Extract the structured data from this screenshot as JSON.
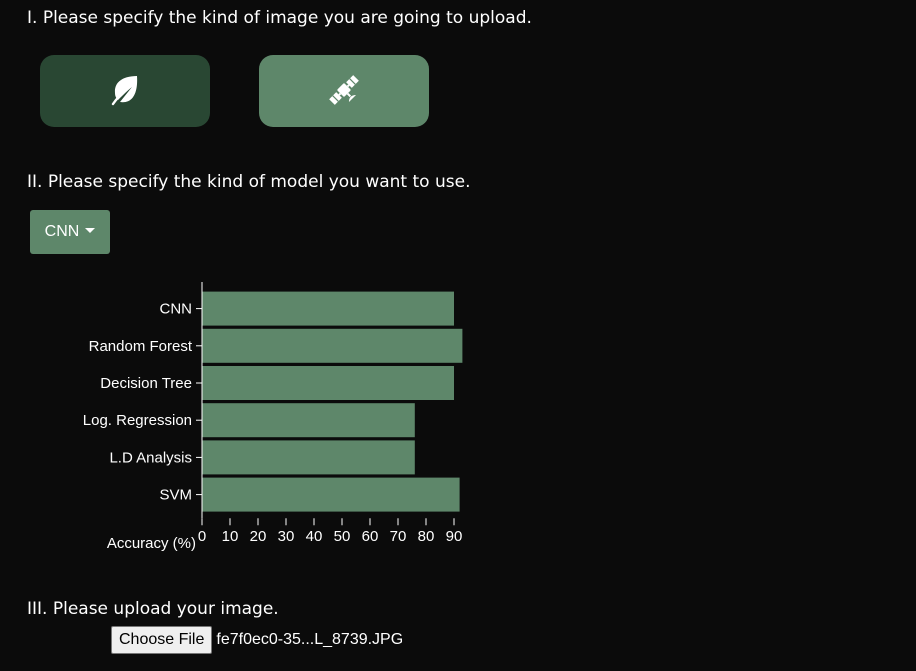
{
  "sections": {
    "image_type_heading": "I. Please specify the kind of image you are going to upload.",
    "model_heading": "II. Please specify the kind of model you want to use.",
    "upload_heading": "III. Please upload your image."
  },
  "image_type_buttons": [
    {
      "icon": "leaf-icon",
      "color": "#294733",
      "selected": true
    },
    {
      "icon": "satellite-icon",
      "color": "#5e876a",
      "selected": false
    }
  ],
  "model_dropdown": {
    "selected": "CNN",
    "color": "#5e876a"
  },
  "chart_data": {
    "type": "bar",
    "orientation": "horizontal",
    "categories": [
      "CNN",
      "Random Forest",
      "Decision Tree",
      "Log. Regression",
      "L.D Analysis",
      "SVM"
    ],
    "values": [
      90,
      93,
      90,
      76,
      76,
      92
    ],
    "xlabel": "Accuracy (%)",
    "xticks": [
      0,
      10,
      20,
      30,
      40,
      50,
      60,
      70,
      80,
      90
    ],
    "xlim": [
      0,
      100
    ],
    "bar_color": "#5e876a",
    "grid": false
  },
  "upload": {
    "button_label": "Choose File",
    "file_name": "fe7f0ec0-35...L_8739.JPG"
  },
  "colors": {
    "background": "#0b0b0b",
    "dark_green": "#294733",
    "accent_green": "#5e876a"
  }
}
